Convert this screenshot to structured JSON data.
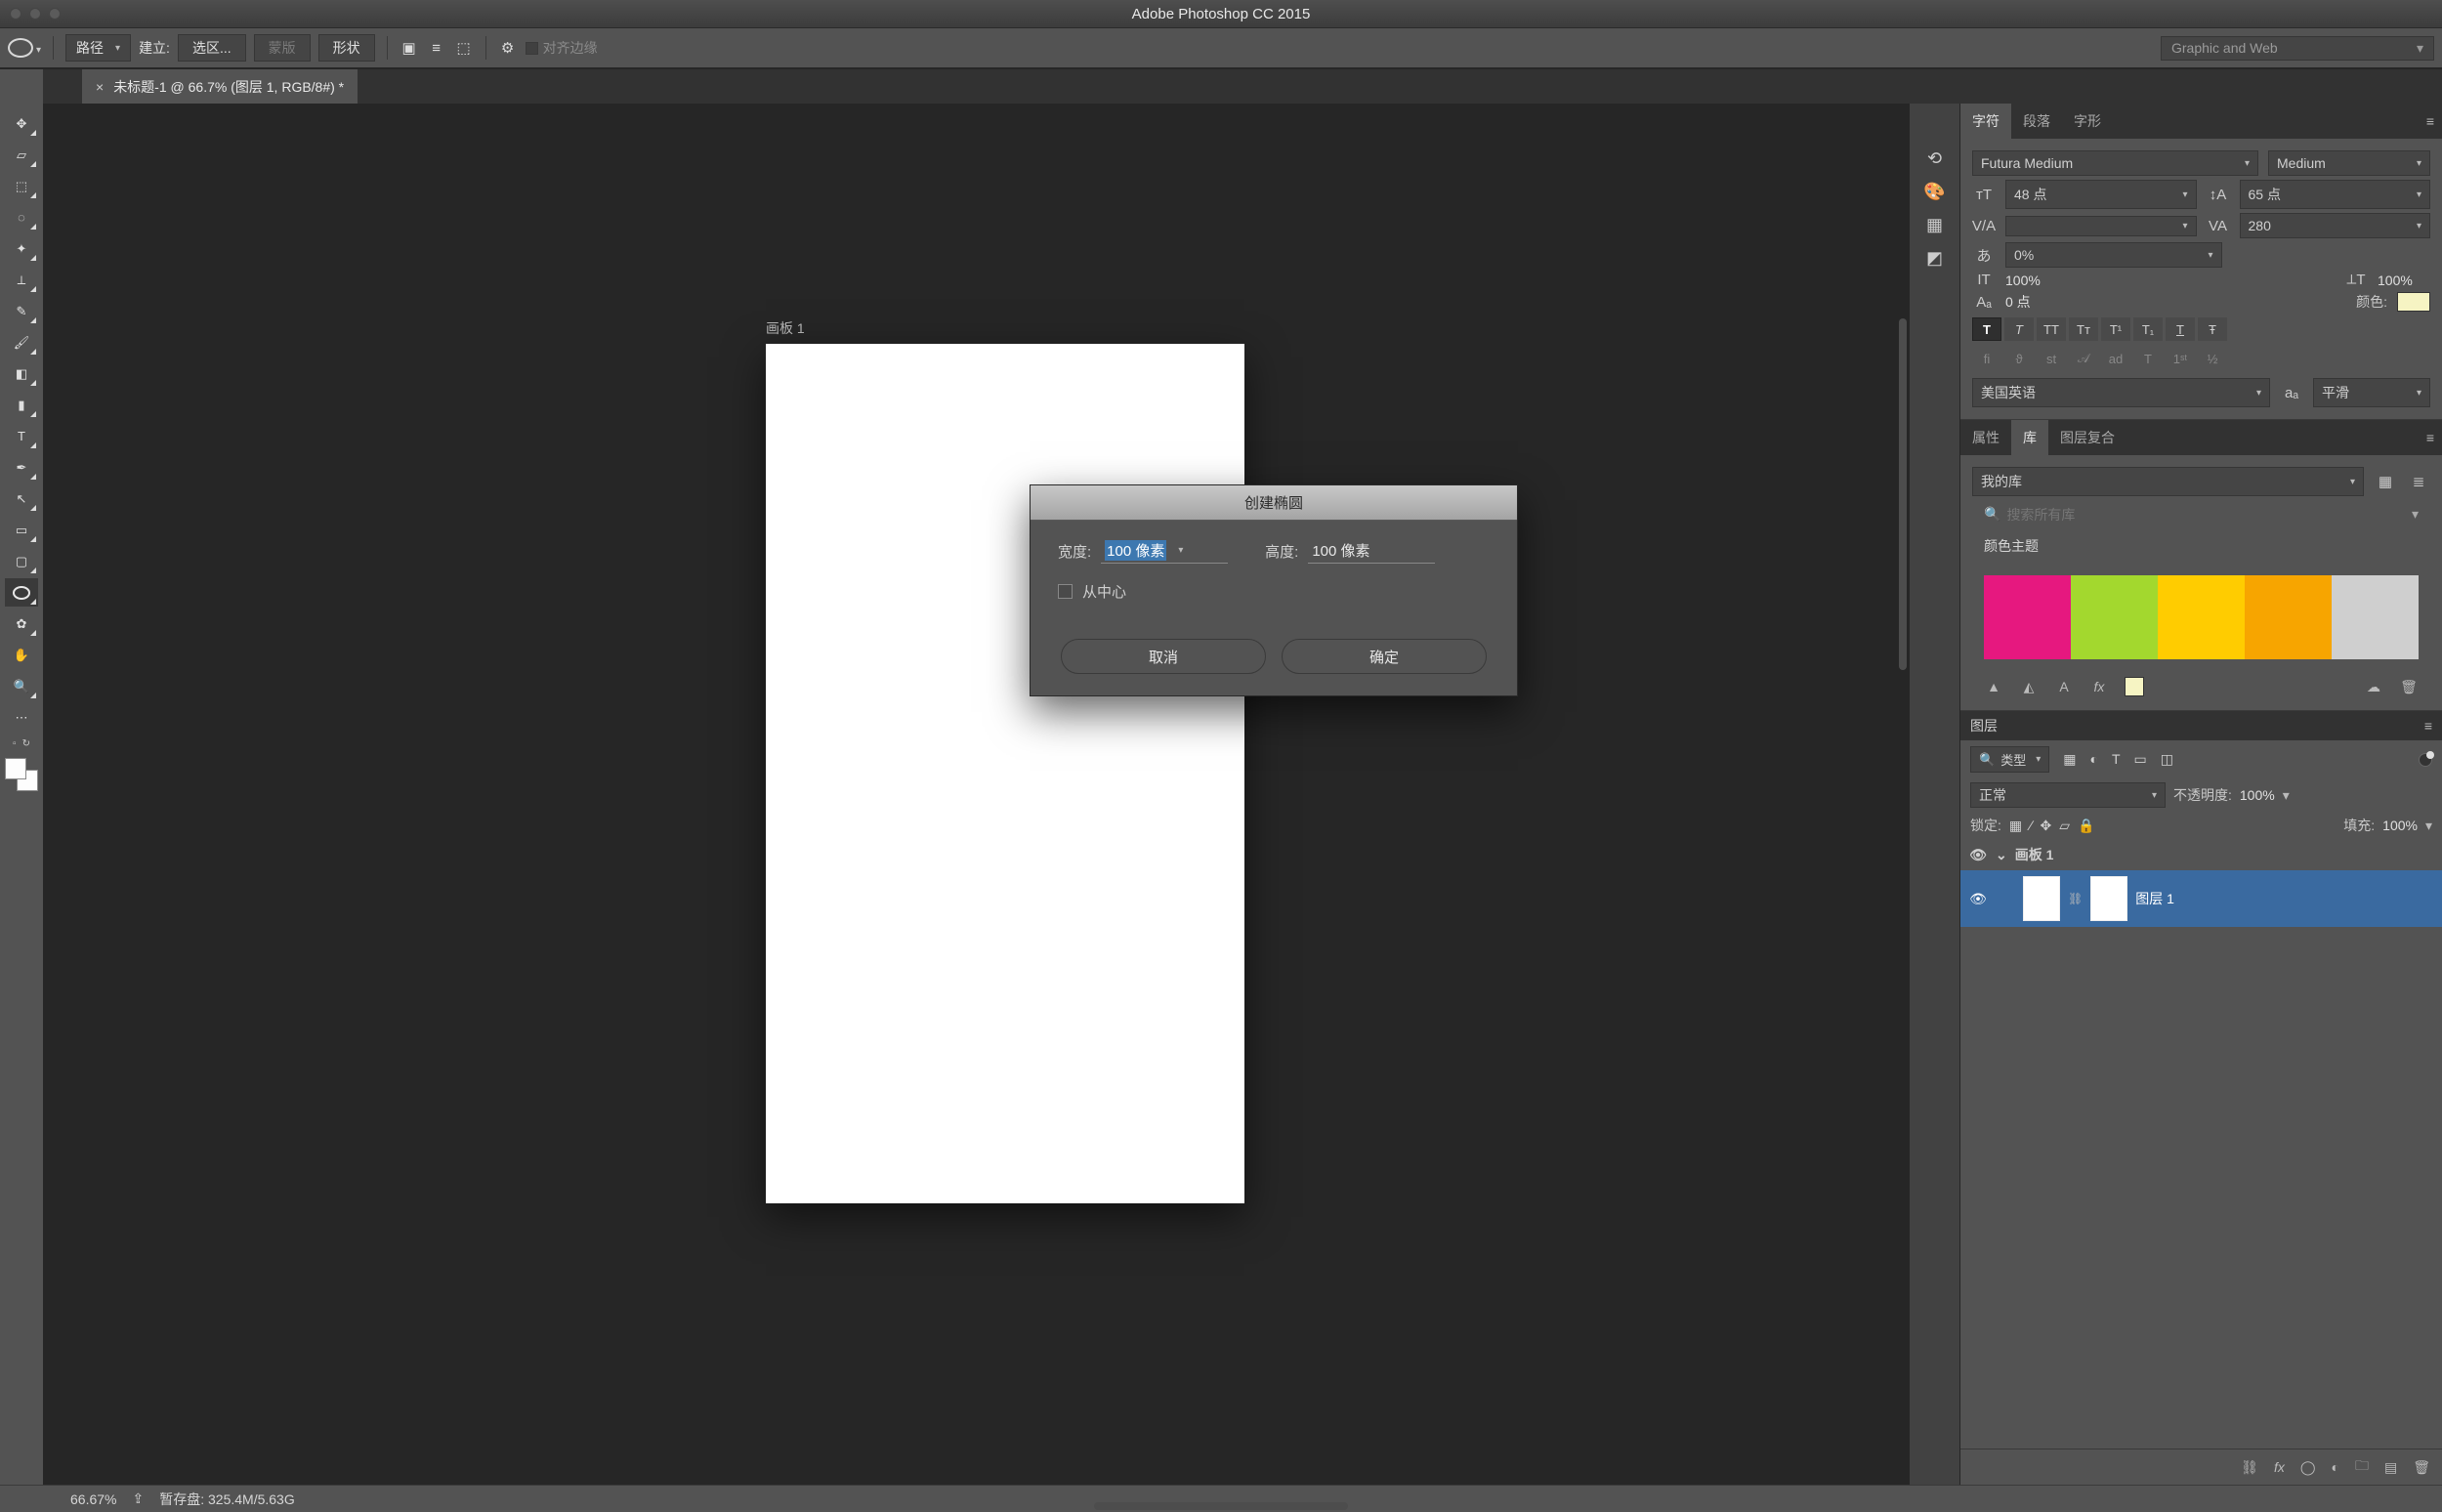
{
  "app_title": "Adobe Photoshop CC 2015",
  "options_bar": {
    "mode_label": "路径",
    "build_label": "建立:",
    "selection_btn": "选区...",
    "mask_btn": "蒙版",
    "shape_btn": "形状",
    "gear_icon": "gear-icon",
    "align_edges_label": "对齐边缘",
    "preset": "Graphic and Web"
  },
  "document": {
    "tab_title": "未标题-1 @ 66.7% (图层 1, RGB/8#) *",
    "artboard_label": "画板 1"
  },
  "dialog": {
    "title": "创建椭圆",
    "width_label": "宽度:",
    "width_value": "100 像素",
    "height_label": "高度:",
    "height_value": "100 像素",
    "from_center_label": "从中心",
    "cancel": "取消",
    "ok": "确定"
  },
  "panels": {
    "char_tabs": {
      "a": "字符",
      "b": "段落",
      "c": "字形"
    },
    "font_family": "Futura Medium",
    "font_style": "Medium",
    "font_size": "48 点",
    "leading": "65 点",
    "kerning": "",
    "tracking": "280",
    "vscale": "100%",
    "hscale": "100%",
    "baseline": "0 点",
    "color_label": "颜色:",
    "vshift_pct": "0%",
    "lang": "美国英语",
    "aa": "平滑",
    "prop_tabs": {
      "a": "属性",
      "b": "库",
      "c": "图层复合"
    },
    "lib_name": "我的库",
    "lib_search_placeholder": "搜索所有库",
    "color_theme_label": "颜色主题",
    "swatches": [
      "#e6187f",
      "#a3d82e",
      "#ffcc00",
      "#f7a500",
      "#cfcfcf"
    ],
    "layers": {
      "tab": "图层",
      "filter_label": "类型",
      "blend": "正常",
      "opacity_label": "不透明度:",
      "opacity": "100%",
      "lock_label": "锁定:",
      "fill_label": "填充:",
      "fill": "100%",
      "artboard_name": "画板 1",
      "layer1_name": "图层 1"
    }
  },
  "status": {
    "zoom": "66.67%",
    "scratch": "暂存盘: 325.4M/5.63G"
  }
}
